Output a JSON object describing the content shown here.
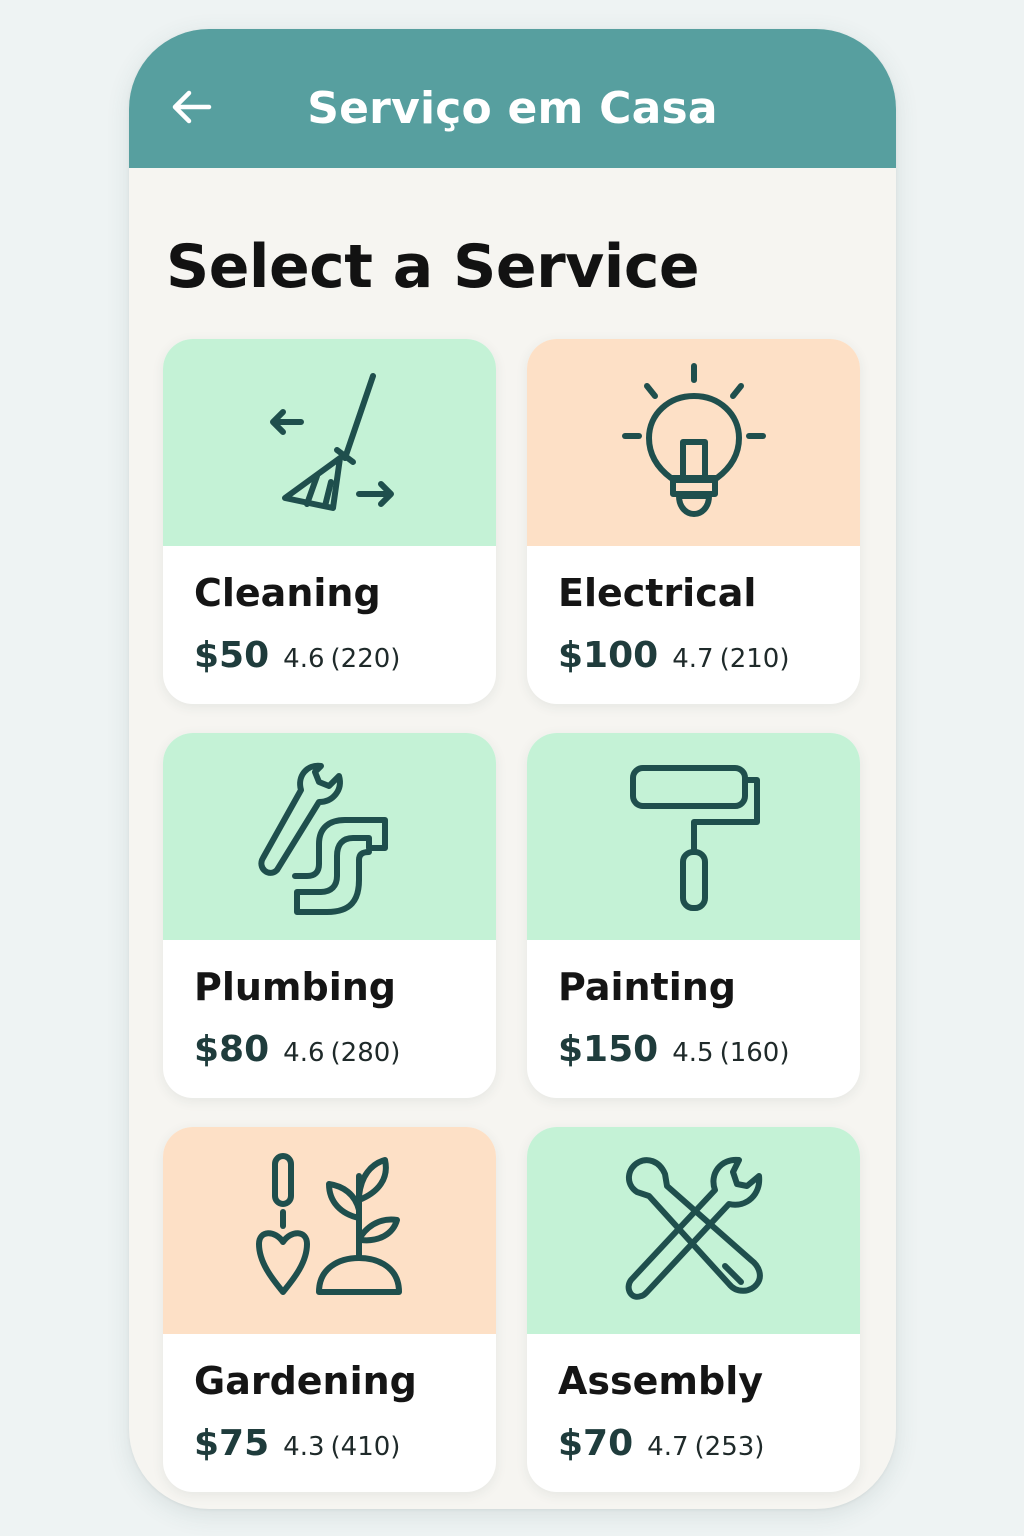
{
  "header": {
    "title": "Serviço em Casa",
    "back_icon": "arrow-left-icon"
  },
  "page": {
    "title": "Select a Service"
  },
  "colors": {
    "header_bg": "#579f9f",
    "green_tile": "#c4f2d6",
    "peach_tile": "#fde0c6",
    "icon_stroke": "#1f4f4d"
  },
  "services": [
    {
      "name": "Cleaning",
      "price": "$50",
      "rating": "4.6",
      "reviews": "(220)",
      "icon": "broom-icon",
      "tile_color": "#c4f2d6"
    },
    {
      "name": "Electrical",
      "price": "$100",
      "rating": "4.7",
      "reviews": "(210)",
      "icon": "lightbulb-icon",
      "tile_color": "#fde0c6"
    },
    {
      "name": "Plumbing",
      "price": "$80",
      "rating": "4.6",
      "reviews": "(280)",
      "icon": "wrench-pipe-icon",
      "tile_color": "#c4f2d6"
    },
    {
      "name": "Painting",
      "price": "$150",
      "rating": "4.5",
      "reviews": "(160)",
      "icon": "paint-roller-icon",
      "tile_color": "#c4f2d6"
    },
    {
      "name": "Gardening",
      "price": "$75",
      "rating": "4.3",
      "reviews": "(410)",
      "icon": "trowel-plant-icon",
      "tile_color": "#fde0c6"
    },
    {
      "name": "Assembly",
      "price": "$70",
      "rating": "4.7",
      "reviews": "(253)",
      "icon": "tools-icon",
      "tile_color": "#c4f2d6"
    }
  ]
}
